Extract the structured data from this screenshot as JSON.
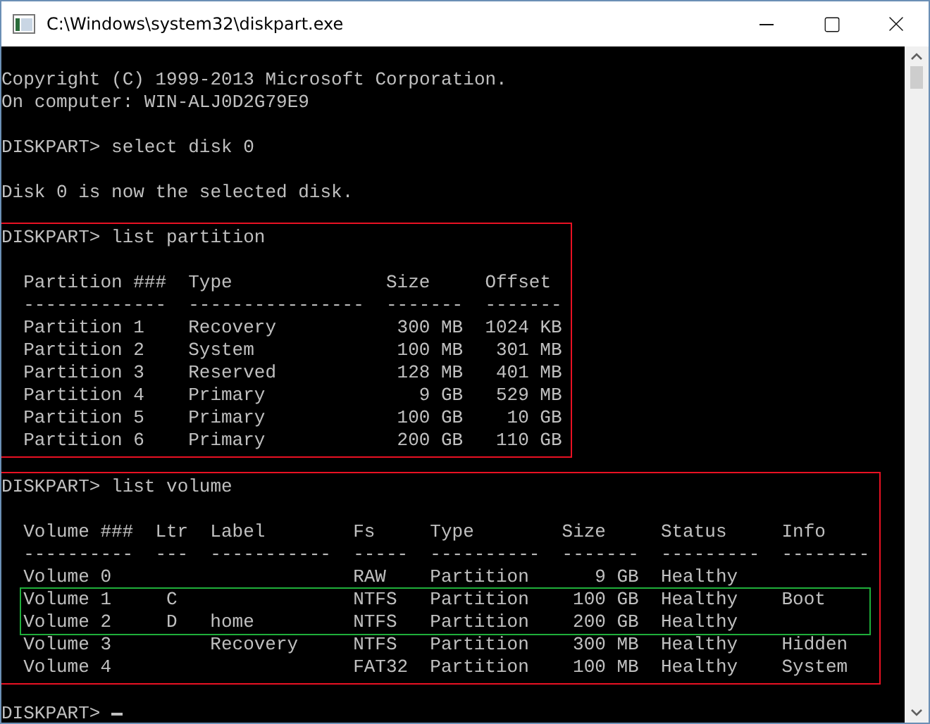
{
  "window": {
    "title": "C:\\Windows\\system32\\diskpart.exe"
  },
  "console": {
    "blocks": [
      {
        "kind": "output",
        "lines": [
          "Copyright (C) 1999-2013 Microsoft Corporation.",
          "On computer: WIN-ALJ0D2G79E9"
        ]
      },
      {
        "kind": "command",
        "text": "DISKPART> select disk 0"
      },
      {
        "kind": "output",
        "lines": [
          "Disk 0 is now the selected disk."
        ]
      },
      {
        "kind": "table",
        "highlighted": true,
        "text": "DISKPART> list partition",
        "table": {
          "columns": [
            {
              "header": "Partition ###",
              "rule": "-------------"
            },
            {
              "header": "Type",
              "rule": "----------------"
            },
            {
              "header": "Size",
              "rule": "-------"
            },
            {
              "header": "Offset",
              "rule": "-------"
            }
          ],
          "rows": [
            {
              "cells": [
                "Partition 1",
                "Recovery",
                "300 MB",
                "1024 KB"
              ]
            },
            {
              "cells": [
                "Partition 2",
                "System",
                "100 MB",
                "301 MB"
              ]
            },
            {
              "cells": [
                "Partition 3",
                "Reserved",
                "128 MB",
                "401 MB"
              ]
            },
            {
              "cells": [
                "Partition 4",
                "Primary",
                "9 GB",
                "529 MB"
              ]
            },
            {
              "cells": [
                "Partition 5",
                "Primary",
                "100 GB",
                "10 GB"
              ]
            },
            {
              "cells": [
                "Partition 6",
                "Primary",
                "200 GB",
                "110 GB"
              ]
            }
          ]
        }
      },
      {
        "kind": "table",
        "highlighted": true,
        "text": "DISKPART> list volume",
        "table": {
          "columns": [
            {
              "header": "Volume ###",
              "rule": "----------"
            },
            {
              "header": "Ltr",
              "rule": "---"
            },
            {
              "header": "Label",
              "rule": "-----------"
            },
            {
              "header": "Fs",
              "rule": "-----"
            },
            {
              "header": "Type",
              "rule": "----------"
            },
            {
              "header": "Size",
              "rule": "-------"
            },
            {
              "header": "Status",
              "rule": "---------"
            },
            {
              "header": "Info",
              "rule": "--------"
            }
          ],
          "rows": [
            {
              "highlighted": false,
              "cells": [
                "Volume 0",
                null,
                null,
                "RAW",
                "Partition",
                "9 GB",
                "Healthy",
                null
              ]
            },
            {
              "highlighted": true,
              "cells": [
                "Volume 1",
                "C",
                null,
                "NTFS",
                "Partition",
                "100 GB",
                "Healthy",
                "Boot"
              ]
            },
            {
              "highlighted": true,
              "cells": [
                "Volume 2",
                "D",
                "home",
                "NTFS",
                "Partition",
                "200 GB",
                "Healthy",
                null
              ]
            },
            {
              "highlighted": false,
              "cells": [
                "Volume 3",
                null,
                "Recovery",
                "NTFS",
                "Partition",
                "300 MB",
                "Healthy",
                "Hidden"
              ]
            },
            {
              "highlighted": false,
              "cells": [
                "Volume 4",
                null,
                null,
                "FAT32",
                "Partition",
                "100 MB",
                "Healthy",
                "System"
              ]
            }
          ]
        }
      },
      {
        "kind": "prompt",
        "text": "DISKPART>",
        "cursor": true
      }
    ]
  }
}
